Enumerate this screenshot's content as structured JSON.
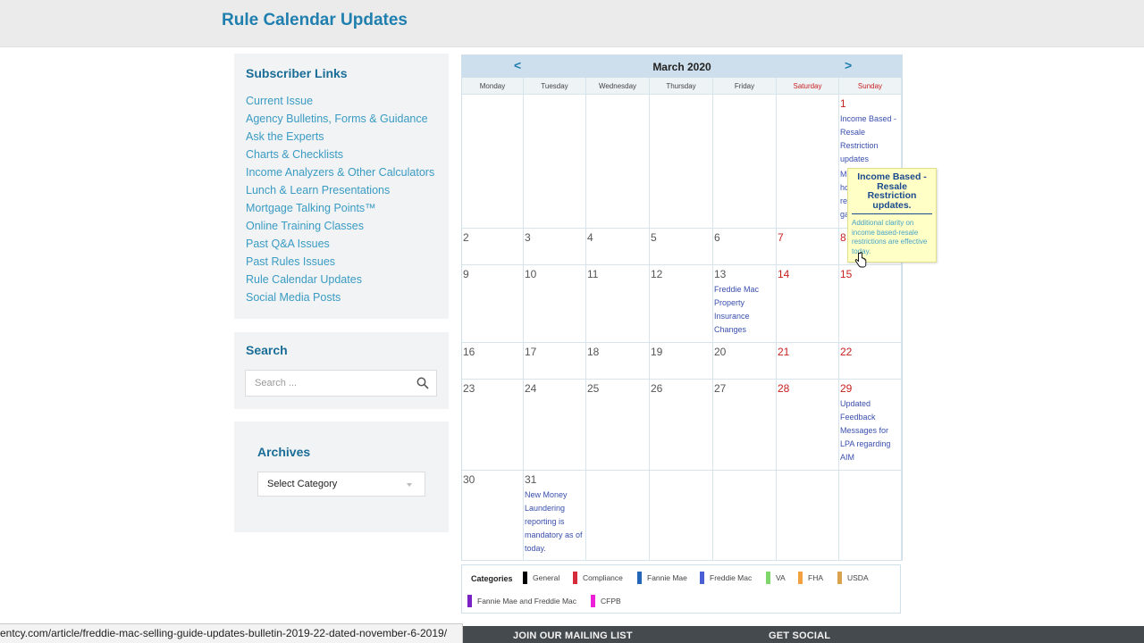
{
  "header": {
    "title": "Rule Calendar Updates"
  },
  "sidebar": {
    "links_title": "Subscriber Links",
    "links": [
      "Current Issue",
      "Agency Bulletins, Forms & Guidance",
      "Ask the Experts",
      "Charts & Checklists",
      "Income Analyzers & Other Calculators",
      "Lunch & Learn Presentations",
      "Mortgage Talking Points™",
      "Online Training Classes",
      "Past Q&A Issues",
      "Past Rules Issues",
      "Rule Calendar Updates",
      "Social Media Posts"
    ],
    "search_title": "Search",
    "search_placeholder": "Search ...",
    "archives_title": "Archives",
    "archives_selected": "Select Category"
  },
  "calendar": {
    "month_label": "March 2020",
    "prev_label": "<",
    "next_label": ">",
    "weekdays": [
      "Monday",
      "Tuesday",
      "Wednesday",
      "Thursday",
      "Friday",
      "Saturday",
      "Sunday"
    ],
    "weeks": [
      [
        "",
        "",
        "",
        "",
        "",
        "",
        "1"
      ],
      [
        "2",
        "3",
        "4",
        "5",
        "6",
        "7",
        "8"
      ],
      [
        "9",
        "10",
        "11",
        "12",
        "13",
        "14",
        "15"
      ],
      [
        "16",
        "17",
        "18",
        "19",
        "20",
        "21",
        "22"
      ],
      [
        "23",
        "24",
        "25",
        "26",
        "27",
        "28",
        "29"
      ],
      [
        "30",
        "31",
        "",
        "",
        "",
        "",
        ""
      ]
    ],
    "events": {
      "1": "Income Based - Resale Restriction updates",
      "1b": "M\nho\nre\nga",
      "13": "Freddie Mac Property Insurance Changes",
      "29": "Updated Feedback Messages for LPA regarding AIM",
      "31": "New Money Laundering reporting is mandatory as of today."
    },
    "tooltip": {
      "title": "Income Based - Resale Restriction updates.",
      "body": "Additional clarity on income based-resale restrictions are effective today."
    }
  },
  "legend": {
    "label": "Categories",
    "items": [
      {
        "name": "General",
        "color": "#000000"
      },
      {
        "name": "Compliance",
        "color": "#d62b3a"
      },
      {
        "name": "Fannie Mae",
        "color": "#2366b8"
      },
      {
        "name": "Freddie Mac",
        "color": "#4a5ed6"
      },
      {
        "name": "VA",
        "color": "#7fd66a"
      },
      {
        "name": "FHA",
        "color": "#f2a040"
      },
      {
        "name": "USDA",
        "color": "#dba24e"
      },
      {
        "name": "Fannie Mae and Freddie Mac",
        "color": "#7b22c4"
      },
      {
        "name": "CFPB",
        "color": "#ee1fd8"
      }
    ]
  },
  "status_url": "entcy.com/article/freddie-mac-selling-guide-updates-bulletin-2019-22-dated-november-6-2019/",
  "footer": {
    "mailing": "JOIN OUR MAILING LIST",
    "social": "GET SOCIAL"
  }
}
